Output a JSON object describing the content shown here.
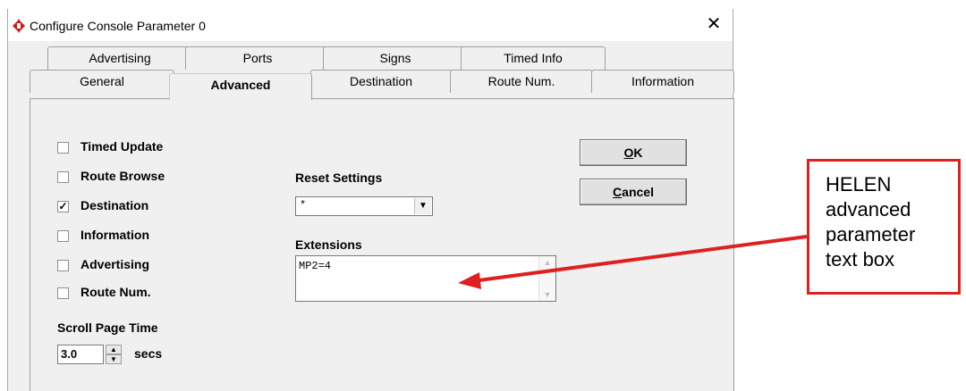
{
  "window": {
    "title": "Configure Console Parameter 0",
    "close_glyph": "✕"
  },
  "tabs_back": [
    "Advertising",
    "Ports",
    "Signs",
    "Timed Info"
  ],
  "tabs_front": [
    "General",
    "Advanced",
    "Destination",
    "Route Num.",
    "Information"
  ],
  "active_tab": "Advanced",
  "checkboxes": [
    {
      "label": "Timed Update",
      "checked": false,
      "mark": ""
    },
    {
      "label": "Route Browse",
      "checked": false,
      "mark": ""
    },
    {
      "label": "Destination",
      "checked": true,
      "mark": "✓"
    },
    {
      "label": "Information",
      "checked": false,
      "mark": ""
    },
    {
      "label": "Advertising",
      "checked": false,
      "mark": ""
    },
    {
      "label": "Route Num.",
      "checked": false,
      "mark": ""
    }
  ],
  "scroll": {
    "label": "Scroll Page Time",
    "value": "3.0",
    "unit": "secs",
    "up": "▲",
    "down": "▼"
  },
  "reset": {
    "label": "Reset Settings",
    "value": "*",
    "arrow": "▼"
  },
  "extensions": {
    "label": "Extensions",
    "value": "MP2=4",
    "up": "▲",
    "down": "▼"
  },
  "buttons": {
    "ok_prefix": "",
    "ok_u": "O",
    "ok_suffix": "K",
    "cancel_u": "C",
    "cancel_suffix": "ancel"
  },
  "annotation": {
    "text": "HELEN advanced parameter text box",
    "color": "#e02020"
  }
}
